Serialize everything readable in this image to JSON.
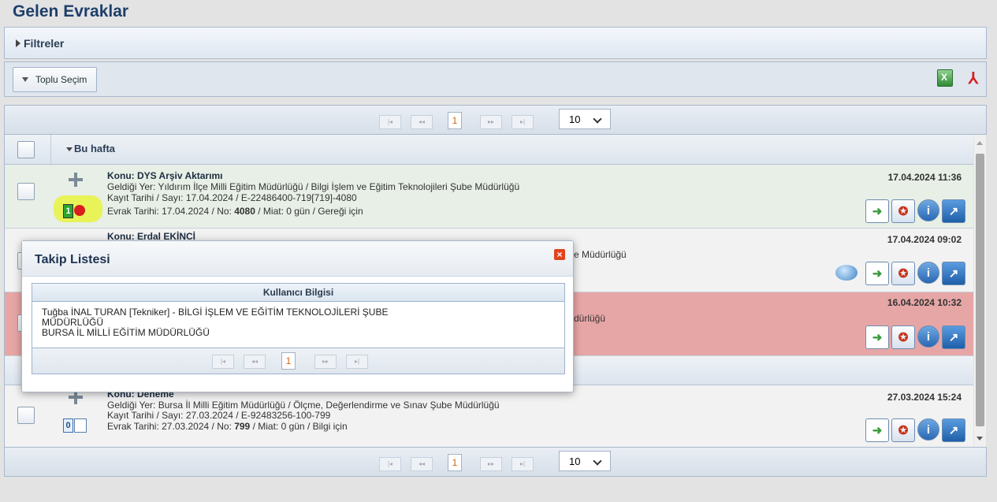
{
  "page_title": "Gelen Evraklar",
  "filters_label": "Filtreler",
  "toolbar": {
    "toplu_label": "Toplu Seçim",
    "excel_icon": "excel-icon",
    "pdf_icon": "pdf-icon"
  },
  "pager": {
    "first": "|◂",
    "prev": "◂◂",
    "current": "1",
    "next": "▸▸",
    "last": "▸|",
    "page_size": "10"
  },
  "group": {
    "label": "Bu hafta"
  },
  "rows": [
    {
      "konu": "Konu: DYS Arşiv Aktarımı",
      "geldigi": "Geldiği Yer: Yıldırım İlçe Milli Eğitim Müdürlüğü / Bilgi İşlem ve Eğitim Teknolojileri Şube Müdürlüğü",
      "kayit": "Kayıt Tarihi / Sayı: 17.04.2024 / E-22486400-719[719]-4080",
      "evrak_prefix": "Evrak Tarihi: 17.04.2024 / No: ",
      "evrak_no": "4080",
      "evrak_suffix": " / Miat: 0 gün / Gereği için",
      "datetime": "17.04.2024 11:36",
      "badge": "1"
    },
    {
      "konu": "Konu: Erdal EKİNCİ",
      "geldigi_tail": "e Müdürlüğü",
      "datetime": "17.04.2024 09:02"
    },
    {
      "geldigi_tail": "dürlüğü",
      "datetime": "16.04.2024 10:32"
    },
    {
      "konu": "Konu: Deneme",
      "geldigi": "Geldiği Yer: Bursa İl Milli Eğitim Müdürlüğü / Ölçme, Değerlendirme ve Sınav Şube Müdürlüğü",
      "kayit": "Kayıt Tarihi / Sayı: 27.03.2024 / E-92483256-100-799",
      "evrak_prefix": "Evrak Tarihi: 27.03.2024 / No: ",
      "evrak_no": "799",
      "evrak_suffix": " / Miat: 0 gün / Bilgi için",
      "datetime": "27.03.2024 15:24",
      "badge": "0"
    }
  ],
  "dialog": {
    "title": "Takip Listesi",
    "column": "Kullanıcı Bilgisi",
    "line1": "Tuğba İNAL TURAN [Tekniker] - BİLGİ İŞLEM VE EĞİTİM TEKNOLOJİLERİ ŞUBE",
    "line2": "MÜDÜRLÜĞÜ",
    "line3": "BURSA İL MİLLİ EĞİTİM MÜDÜRLÜĞÜ",
    "page": "1"
  },
  "colors": {
    "title": "#1e3f6b",
    "row_green": "#e7efe6",
    "row_red": "#e7a6a6",
    "highlight": "#e8f250"
  }
}
